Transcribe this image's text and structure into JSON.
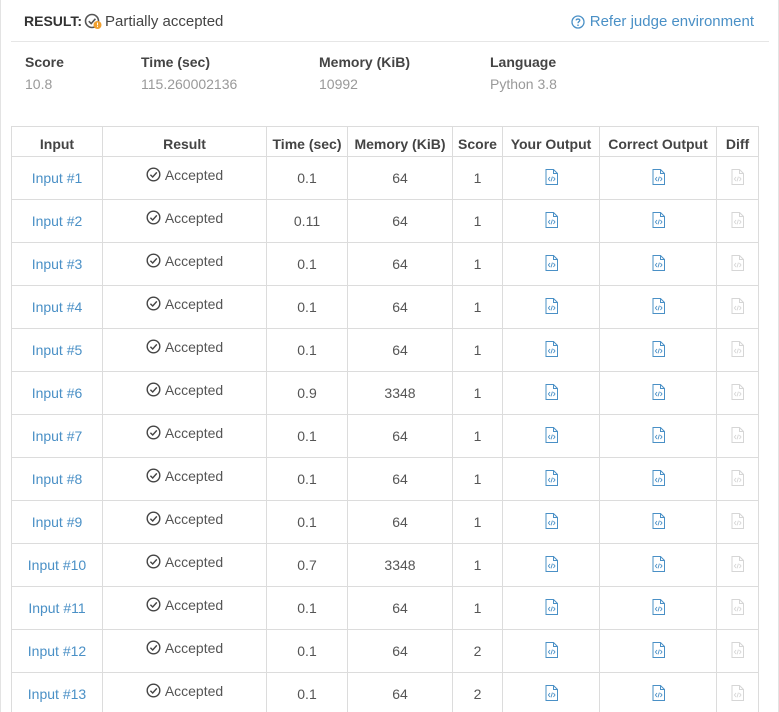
{
  "header": {
    "result_label": "RESULT:",
    "status_text": "Partially accepted",
    "refer_link": "Refer judge environment"
  },
  "summary": {
    "score_label": "Score",
    "score_value": "10.8",
    "time_label": "Time (sec)",
    "time_value": "115.260002136",
    "memory_label": "Memory (KiB)",
    "memory_value": "10992",
    "language_label": "Language",
    "language_value": "Python 3.8"
  },
  "table": {
    "headers": [
      "Input",
      "Result",
      "Time (sec)",
      "Memory (KiB)",
      "Score",
      "Your Output",
      "Correct Output",
      "Diff"
    ],
    "rows": [
      {
        "input": "Input #1",
        "result": "Accepted",
        "time": "0.1",
        "memory": "64",
        "score": "1"
      },
      {
        "input": "Input #2",
        "result": "Accepted",
        "time": "0.11",
        "memory": "64",
        "score": "1"
      },
      {
        "input": "Input #3",
        "result": "Accepted",
        "time": "0.1",
        "memory": "64",
        "score": "1"
      },
      {
        "input": "Input #4",
        "result": "Accepted",
        "time": "0.1",
        "memory": "64",
        "score": "1"
      },
      {
        "input": "Input #5",
        "result": "Accepted",
        "time": "0.1",
        "memory": "64",
        "score": "1"
      },
      {
        "input": "Input #6",
        "result": "Accepted",
        "time": "0.9",
        "memory": "3348",
        "score": "1"
      },
      {
        "input": "Input #7",
        "result": "Accepted",
        "time": "0.1",
        "memory": "64",
        "score": "1"
      },
      {
        "input": "Input #8",
        "result": "Accepted",
        "time": "0.1",
        "memory": "64",
        "score": "1"
      },
      {
        "input": "Input #9",
        "result": "Accepted",
        "time": "0.1",
        "memory": "64",
        "score": "1"
      },
      {
        "input": "Input #10",
        "result": "Accepted",
        "time": "0.7",
        "memory": "3348",
        "score": "1"
      },
      {
        "input": "Input #11",
        "result": "Accepted",
        "time": "0.1",
        "memory": "64",
        "score": "1"
      },
      {
        "input": "Input #12",
        "result": "Accepted",
        "time": "0.1",
        "memory": "64",
        "score": "2"
      },
      {
        "input": "Input #13",
        "result": "Accepted",
        "time": "0.1",
        "memory": "64",
        "score": "2"
      }
    ]
  },
  "icons": {
    "status": "partial-accepted-icon",
    "refer": "question-circle-icon",
    "result": "check-circle-icon",
    "your_output": "code-file-icon",
    "correct_output": "code-file-icon",
    "diff": "diff-file-icon-disabled"
  },
  "colors": {
    "link": "#4a90c6",
    "disabled_icon": "#d6d6d6",
    "warning_badge": "#f0a030"
  }
}
